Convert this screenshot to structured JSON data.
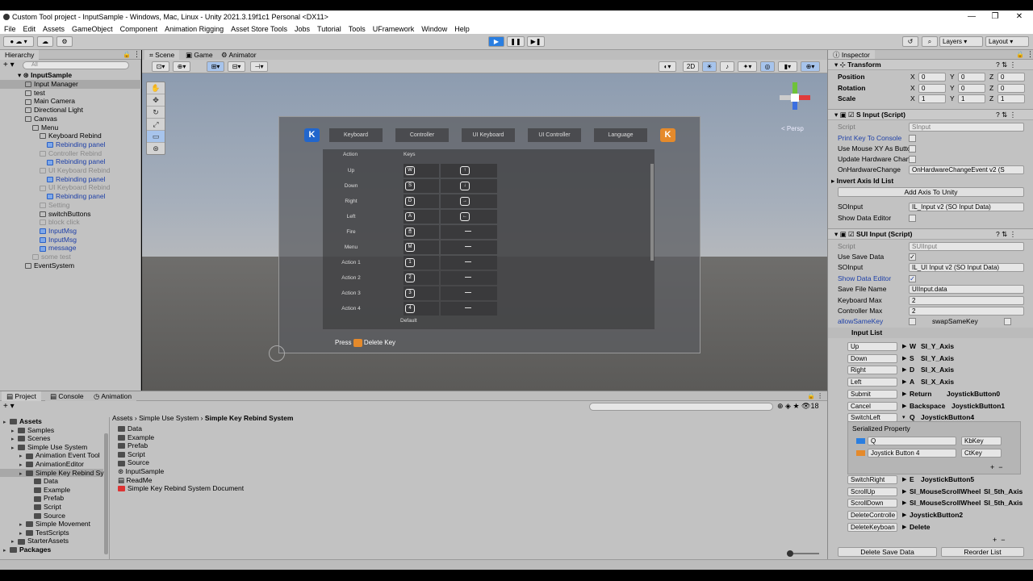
{
  "window": {
    "title": "Custom Tool project - InputSample - Windows, Mac, Linux - Unity 2021.3.19f1c1 Personal <DX11>"
  },
  "menu": [
    "File",
    "Edit",
    "Assets",
    "GameObject",
    "Component",
    "Animation Rigging",
    "Asset Store Tools",
    "Jobs",
    "Tutorial",
    "Tools",
    "UFramework",
    "Window",
    "Help"
  ],
  "toolbar": {
    "layers": "Layers",
    "layout": "Layout"
  },
  "hierarchy": {
    "tab": "Hierarchy",
    "search_placeholder": "All",
    "scene": "InputSample",
    "items": [
      {
        "label": "Input Manager",
        "indent": 1,
        "style": "sel"
      },
      {
        "label": "test",
        "indent": 1,
        "style": ""
      },
      {
        "label": "Main Camera",
        "indent": 1,
        "style": ""
      },
      {
        "label": "Directional Light",
        "indent": 1,
        "style": ""
      },
      {
        "label": "Canvas",
        "indent": 1,
        "style": ""
      },
      {
        "label": "Menu",
        "indent": 2,
        "style": ""
      },
      {
        "label": "Keyboard Rebind",
        "indent": 3,
        "style": ""
      },
      {
        "label": "Rebinding panel",
        "indent": 4,
        "style": "blue"
      },
      {
        "label": "Controller Rebind",
        "indent": 3,
        "style": "dim"
      },
      {
        "label": "Rebinding panel",
        "indent": 4,
        "style": "blue"
      },
      {
        "label": "UI Keyboard Rebind",
        "indent": 3,
        "style": "dim"
      },
      {
        "label": "Rebinding panel",
        "indent": 4,
        "style": "blue"
      },
      {
        "label": "UI Keyboard Rebind",
        "indent": 3,
        "style": "dim"
      },
      {
        "label": "Rebinding panel",
        "indent": 4,
        "style": "blue"
      },
      {
        "label": "Setting",
        "indent": 3,
        "style": "dim"
      },
      {
        "label": "switchButtons",
        "indent": 3,
        "style": ""
      },
      {
        "label": "block click",
        "indent": 3,
        "style": "dim"
      },
      {
        "label": "InputMsg",
        "indent": 3,
        "style": "blue"
      },
      {
        "label": "InputMsg",
        "indent": 3,
        "style": "blue"
      },
      {
        "label": "message",
        "indent": 3,
        "style": "blue"
      },
      {
        "label": "some test",
        "indent": 2,
        "style": "dim"
      },
      {
        "label": "EventSystem",
        "indent": 1,
        "style": ""
      }
    ]
  },
  "scene": {
    "tabs": [
      "Scene",
      "Game",
      "Animator"
    ],
    "mode_2d": "2D",
    "persp": "< Persp",
    "nav": [
      "Keyboard",
      "Controller",
      "UI Keyboard",
      "UI Controller",
      "Language"
    ],
    "k_glyph": "K",
    "table_headers": {
      "action": "Action",
      "keys": "Keys"
    },
    "rows": [
      {
        "name": "Up",
        "k1": "W",
        "k2": "↑"
      },
      {
        "name": "Down",
        "k1": "S",
        "k2": "↓"
      },
      {
        "name": "Right",
        "k1": "D",
        "k2": "→"
      },
      {
        "name": "Left",
        "k1": "A",
        "k2": "←"
      },
      {
        "name": "Fire",
        "k1": "🖱",
        "k2": "—"
      },
      {
        "name": "Menu",
        "k1": "M",
        "k2": "—"
      },
      {
        "name": "Action 1",
        "k1": "1",
        "k2": "—"
      },
      {
        "name": "Action 2",
        "k1": "2",
        "k2": "—"
      },
      {
        "name": "Action 3",
        "k1": "3",
        "k2": "—"
      },
      {
        "name": "Action 4",
        "k1": "4",
        "k2": "—"
      }
    ],
    "default_label": "Default",
    "press_label": "Press",
    "delete_label": "Delete Key"
  },
  "inspector": {
    "tab": "Inspector",
    "transform": {
      "title": "Transform",
      "position": {
        "label": "Position",
        "x": "0",
        "y": "0",
        "z": "0"
      },
      "rotation": {
        "label": "Rotation",
        "x": "0",
        "y": "0",
        "z": "0"
      },
      "scale": {
        "label": "Scale",
        "x": "1",
        "y": "1",
        "z": "1"
      }
    },
    "sinput": {
      "title": "S Input (Script)",
      "script_label": "Script",
      "script_value": "SInput",
      "print_key": "Print Key To Console",
      "use_mouse": "Use Mouse XY As Butto",
      "update_hw": "Update Hardware Chan",
      "on_hw_label": "OnHardwareChange",
      "on_hw_value": "OnHardwareChangeEvent v2 (S",
      "invert_axis": "Invert Axis Id List",
      "add_axis": "Add Axis To Unity",
      "so_label": "SOInput",
      "so_value": "IL_Input v2 (SO Input Data)",
      "show_editor": "Show Data Editor"
    },
    "suiinput": {
      "title": "SUI Input (Script)",
      "script_label": "Script",
      "script_value": "SUIInput",
      "use_save": "Use Save Data",
      "so_label": "SOInput",
      "so_value": "IL_UI Input v2 (SO Input Data)",
      "show_editor": "Show Data Editor",
      "save_file_label": "Save File Name",
      "save_file_value": "UIInput.data",
      "kb_max_label": "Keyboard Max",
      "kb_max_value": "2",
      "ct_max_label": "Controller Max",
      "ct_max_value": "2",
      "allow_same": "allowSameKey",
      "swap_same": "swapSameKey",
      "input_list": "Input List",
      "inputs": [
        {
          "name": "Up",
          "k": "W",
          "a": "SI_Y_Axis",
          "b": ""
        },
        {
          "name": "Down",
          "k": "S",
          "a": "SI_Y_Axis",
          "b": ""
        },
        {
          "name": "Right",
          "k": "D",
          "a": "SI_X_Axis",
          "b": ""
        },
        {
          "name": "Left",
          "k": "A",
          "a": "SI_X_Axis",
          "b": ""
        },
        {
          "name": "Submit",
          "k": "Return",
          "a": "JoystickButton0",
          "b": ""
        },
        {
          "name": "Cancel",
          "k": "Backspace",
          "a": "JoystickButton1",
          "b": ""
        },
        {
          "name": "SwitchLeft",
          "k": "Q",
          "a": "JoystickButton4",
          "b": ""
        }
      ],
      "serialized": "Serialized Property",
      "sp_rows": [
        {
          "value": "Q",
          "type": "KbKey"
        },
        {
          "value": "Joystick Button 4",
          "type": "CtKey"
        }
      ],
      "inputs2": [
        {
          "name": "SwitchRight",
          "k": "E",
          "a": "JoystickButton5",
          "b": ""
        },
        {
          "name": "ScrollUp",
          "k": "SI_MouseScrollWheel",
          "a": "SI_5th_Axis",
          "b": ""
        },
        {
          "name": "ScrollDown",
          "k": "SI_MouseScrollWheel",
          "a": "SI_5th_Axis",
          "b": ""
        },
        {
          "name": "DeleteControlle",
          "k": "JoystickButton2",
          "a": "",
          "b": ""
        },
        {
          "name": "DeleteKeyboan",
          "k": "Delete",
          "a": "",
          "b": ""
        }
      ],
      "delete_save": "Delete Save Data",
      "reorder": "Reorder List"
    }
  },
  "project": {
    "tabs": [
      "Project",
      "Console",
      "Animation"
    ],
    "count": "18",
    "breadcrumb": [
      "Assets",
      "Simple Use System",
      "Simple Key Rebind System"
    ],
    "tree": [
      {
        "label": "Assets",
        "indent": 0,
        "bold": true
      },
      {
        "label": "Samples",
        "indent": 1
      },
      {
        "label": "Scenes",
        "indent": 1
      },
      {
        "label": "Simple Use System",
        "indent": 1
      },
      {
        "label": "Animation Event Tool",
        "indent": 2
      },
      {
        "label": "AnimationEditor",
        "indent": 2
      },
      {
        "label": "Simple Key Rebind Sys",
        "indent": 2,
        "sel": true
      },
      {
        "label": "Data",
        "indent": 3
      },
      {
        "label": "Example",
        "indent": 3
      },
      {
        "label": "Prefab",
        "indent": 3
      },
      {
        "label": "Script",
        "indent": 3
      },
      {
        "label": "Source",
        "indent": 3
      },
      {
        "label": "Simple Movement",
        "indent": 2
      },
      {
        "label": "TestScripts",
        "indent": 2
      },
      {
        "label": "StarterAssets",
        "indent": 1
      },
      {
        "label": "Packages",
        "indent": 0,
        "bold": true
      }
    ],
    "files": [
      "Data",
      "Example",
      "Prefab",
      "Script",
      "Source",
      "InputSample",
      "ReadMe",
      "Simple Key Rebind System Document"
    ]
  },
  "colors": {
    "accent": "#2a7ee0",
    "selection": "#a8a8a8",
    "orange": "#e58a2b"
  }
}
